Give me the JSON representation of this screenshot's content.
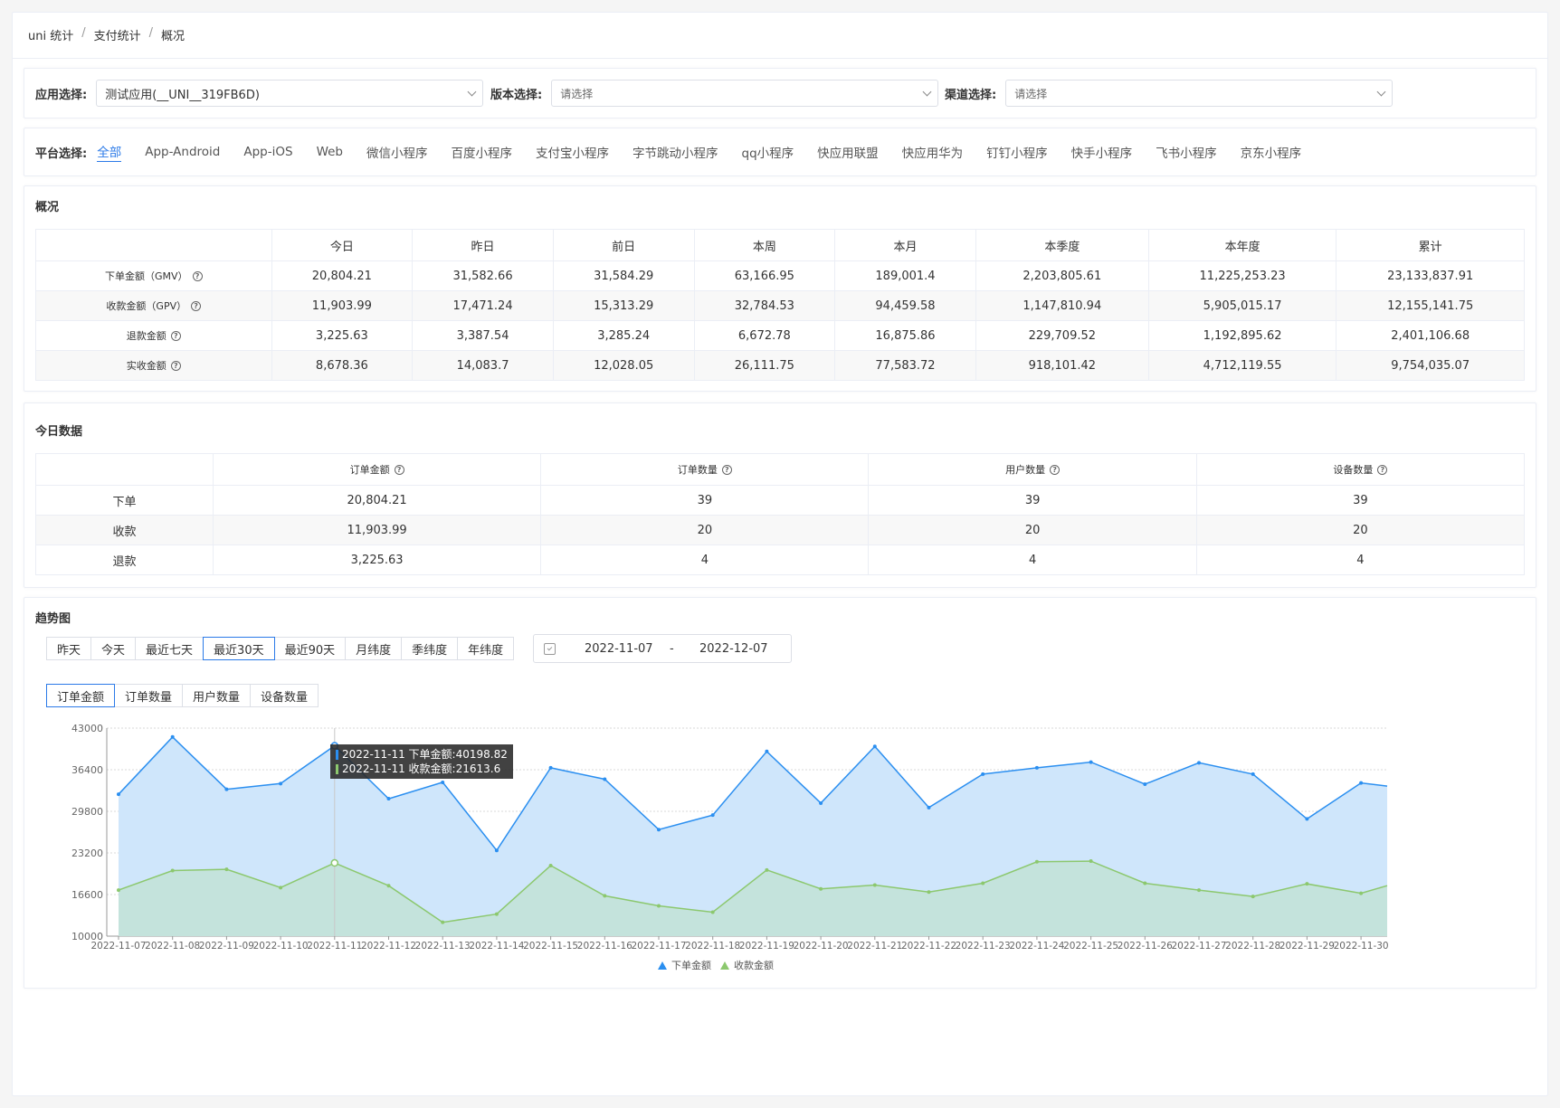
{
  "breadcrumb": [
    "uni 统计",
    "支付统计",
    "概况"
  ],
  "filters": {
    "app": {
      "label": "应用选择:",
      "value": "测试应用(__UNI__319FB6D)"
    },
    "version": {
      "label": "版本选择:",
      "placeholder": "请选择"
    },
    "channel": {
      "label": "渠道选择:",
      "placeholder": "请选择"
    }
  },
  "platforms": {
    "label": "平台选择:",
    "items": [
      "全部",
      "App-Android",
      "App-iOS",
      "Web",
      "微信小程序",
      "百度小程序",
      "支付宝小程序",
      "字节跳动小程序",
      "qq小程序",
      "快应用联盟",
      "快应用华为",
      "钉钉小程序",
      "快手小程序",
      "飞书小程序",
      "京东小程序"
    ],
    "active": 0
  },
  "overview": {
    "title": "概况",
    "columns": [
      "",
      "今日",
      "昨日",
      "前日",
      "本周",
      "本月",
      "本季度",
      "本年度",
      "累计"
    ],
    "rows": [
      {
        "label": "下单金额（GMV）",
        "values": [
          "20,804.21",
          "31,582.66",
          "31,584.29",
          "63,166.95",
          "189,001.4",
          "2,203,805.61",
          "11,225,253.23",
          "23,133,837.91"
        ]
      },
      {
        "label": "收款金额（GPV）",
        "values": [
          "11,903.99",
          "17,471.24",
          "15,313.29",
          "32,784.53",
          "94,459.58",
          "1,147,810.94",
          "5,905,015.17",
          "12,155,141.75"
        ]
      },
      {
        "label": "退款金额",
        "values": [
          "3,225.63",
          "3,387.54",
          "3,285.24",
          "6,672.78",
          "16,875.86",
          "229,709.52",
          "1,192,895.62",
          "2,401,106.68"
        ]
      },
      {
        "label": "实收金额",
        "values": [
          "8,678.36",
          "14,083.7",
          "12,028.05",
          "26,111.75",
          "77,583.72",
          "918,101.42",
          "4,712,119.55",
          "9,754,035.07"
        ]
      }
    ]
  },
  "today": {
    "title": "今日数据",
    "columns": [
      "",
      "订单金额",
      "订单数量",
      "用户数量",
      "设备数量"
    ],
    "rows": [
      {
        "label": "下单",
        "values": [
          "20,804.21",
          "39",
          "39",
          "39"
        ]
      },
      {
        "label": "收款",
        "values": [
          "11,903.99",
          "20",
          "20",
          "20"
        ]
      },
      {
        "label": "退款",
        "values": [
          "3,225.63",
          "4",
          "4",
          "4"
        ]
      }
    ]
  },
  "trend": {
    "title": "趋势图",
    "ranges": [
      "昨天",
      "今天",
      "最近七天",
      "最近30天",
      "最近90天",
      "月纬度",
      "季纬度",
      "年纬度"
    ],
    "active_range": 3,
    "date_start": "2022-11-07",
    "date_sep": "-",
    "date_end": "2022-12-07",
    "metrics": [
      "订单金额",
      "订单数量",
      "用户数量",
      "设备数量"
    ],
    "active_metric": 0,
    "tooltip": [
      "2022-11-11 下单金额:40198.82",
      "2022-11-11 收款金额:21613.6"
    ],
    "tooltip_index": 4
  },
  "chart_data": {
    "type": "area",
    "x": [
      "2022-11-07",
      "2022-11-08",
      "2022-11-09",
      "2022-11-10",
      "2022-11-11",
      "2022-11-12",
      "2022-11-13",
      "2022-11-14",
      "2022-11-15",
      "2022-11-16",
      "2022-11-17",
      "2022-11-18",
      "2022-11-19",
      "2022-11-20",
      "2022-11-21",
      "2022-11-22",
      "2022-11-23",
      "2022-11-24",
      "2022-11-25",
      "2022-11-26",
      "2022-11-27",
      "2022-11-28",
      "2022-11-29",
      "2022-11-30"
    ],
    "yticks": [
      10000,
      16600,
      23200,
      29800,
      36400,
      43000
    ],
    "ylim": [
      10000,
      43000
    ],
    "grid": true,
    "legend_placement": "bottom-center",
    "series": [
      {
        "name": "下单金额",
        "color": "#2b8ff0",
        "fill": "#cfe6fb",
        "values": [
          32500,
          41600,
          33300,
          34200,
          40198.82,
          31800,
          34400,
          23600,
          36700,
          34900,
          26900,
          29200,
          39300,
          31100,
          40100,
          30400,
          35700,
          36700,
          37600,
          34100,
          37500,
          35700,
          28600,
          34300
        ],
        "last": 33800
      },
      {
        "name": "收款金额",
        "color": "#8cc86e",
        "fill": "#c4e3dc",
        "values": [
          17300,
          20400,
          20600,
          17700,
          21613.6,
          18000,
          12200,
          13500,
          21200,
          16400,
          14800,
          13800,
          20500,
          17500,
          18100,
          17000,
          18400,
          21800,
          21900,
          18400,
          17300,
          16300,
          18300,
          16800
        ],
        "last": 18000
      }
    ]
  }
}
